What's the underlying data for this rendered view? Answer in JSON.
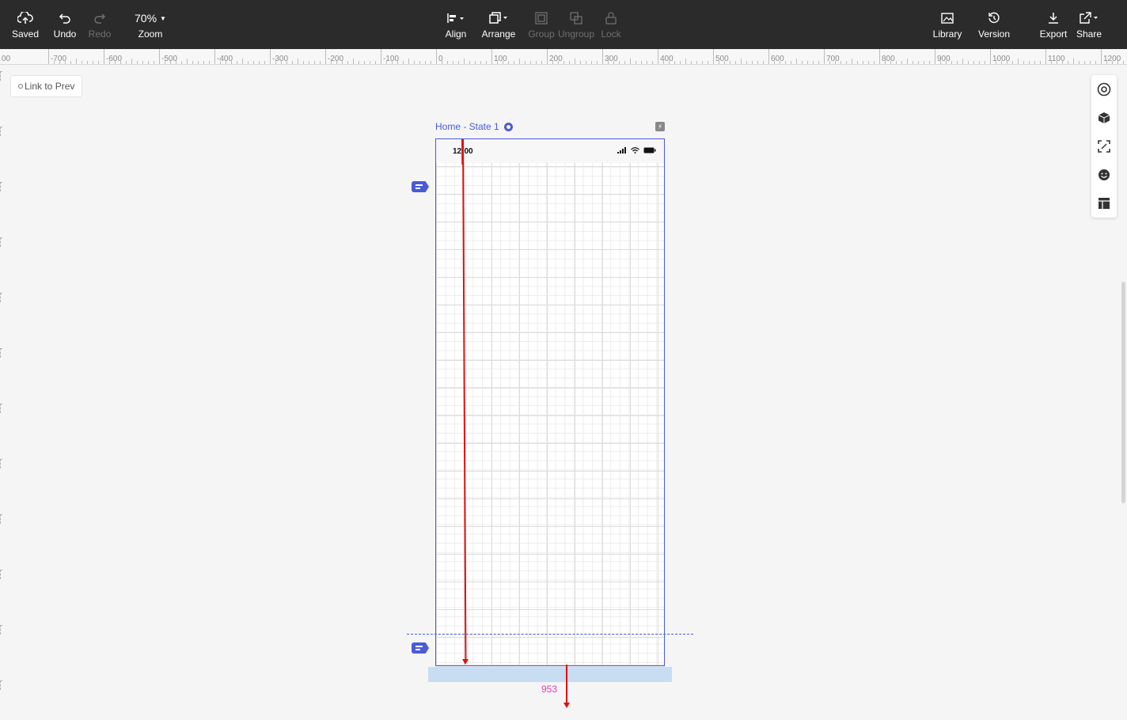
{
  "toolbar": {
    "saved_label": "Saved",
    "undo_label": "Undo",
    "redo_label": "Redo",
    "zoom_value": "70%",
    "zoom_label": "Zoom",
    "align_label": "Align",
    "arrange_label": "Arrange",
    "group_label": "Group",
    "ungroup_label": "Ungroup",
    "lock_label": "Lock",
    "library_label": "Library",
    "version_label": "Version",
    "export_label": "Export",
    "share_label": "Share"
  },
  "ruler": {
    "labels": [
      "-700",
      "-600",
      "-500",
      "-400",
      "-300",
      "-200",
      "-100",
      "0",
      "100",
      "200",
      "300",
      "400",
      "500",
      "600",
      "700",
      "800",
      "900",
      "1000",
      "1100",
      "1200"
    ],
    "left_partial": "00"
  },
  "link_prev": "Link to Prev",
  "artboard": {
    "title": "Home - State 1",
    "status_time": "12:00"
  },
  "measure_value": "953",
  "side_panel_icons": [
    "target-icon",
    "cube-icon",
    "scan-icon",
    "emoji-icon",
    "layout-icon"
  ],
  "colors": {
    "toolbar_bg": "#2b2b2b",
    "accent": "#4a5bd6",
    "guide_red": "#e01010",
    "measure_pink": "#e040b0"
  }
}
